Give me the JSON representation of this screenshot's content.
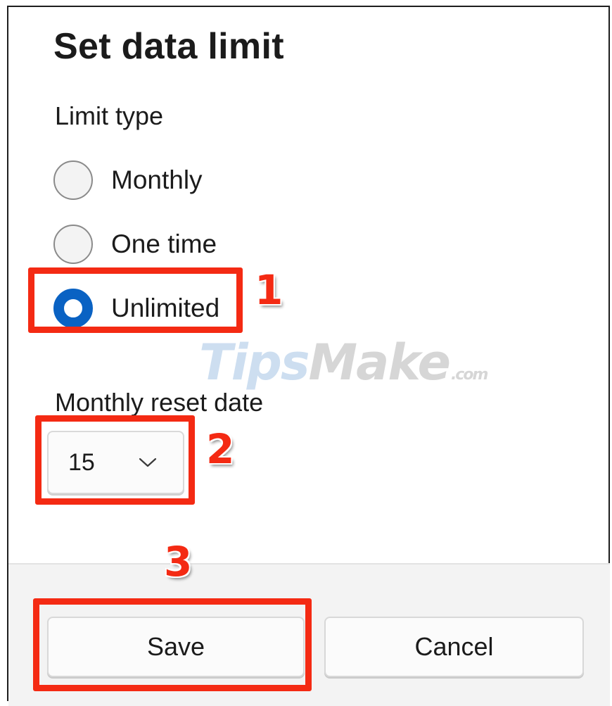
{
  "dialog": {
    "title": "Set data limit",
    "limit_type_label": "Limit type",
    "options": [
      {
        "label": "Monthly",
        "checked": false
      },
      {
        "label": "One time",
        "checked": false
      },
      {
        "label": "Unlimited",
        "checked": true
      }
    ],
    "reset_date_label": "Monthly reset date",
    "reset_date_value": "15",
    "save_label": "Save",
    "cancel_label": "Cancel"
  },
  "annotations": {
    "step1": "1",
    "step2": "2",
    "step3": "3",
    "color": "#f42a13"
  },
  "watermark": {
    "part1": "Tips",
    "part2": "Make",
    "part3": ".com"
  },
  "colors": {
    "accent": "#0a62c3",
    "footer_bg": "#f3f3f3"
  },
  "icons": {
    "dropdown": "chevron-down-icon"
  }
}
